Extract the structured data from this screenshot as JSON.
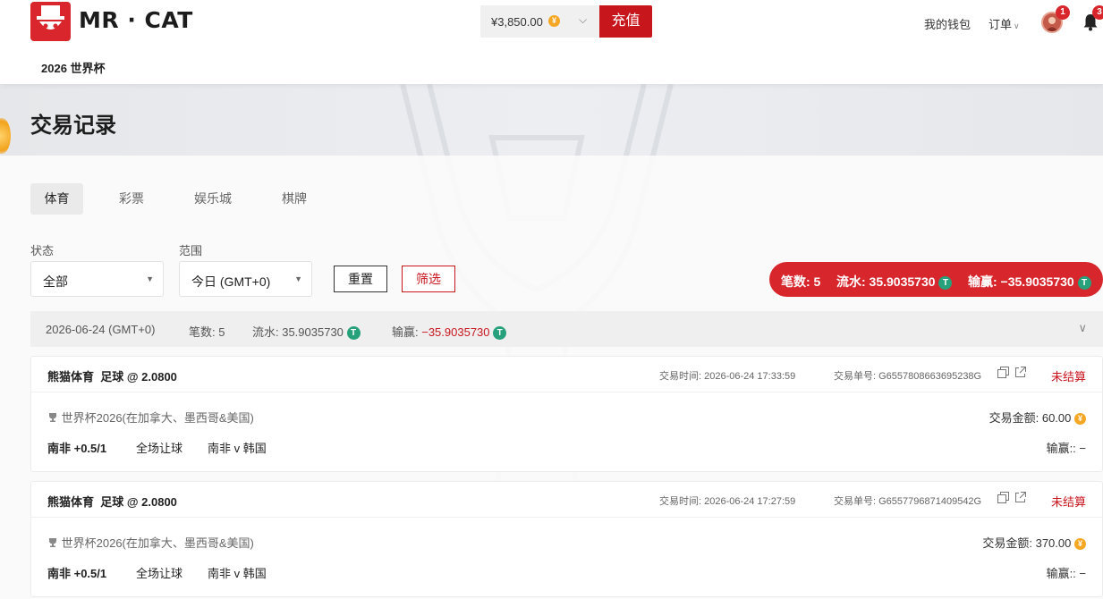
{
  "header": {
    "logo_text": "MR · CAT",
    "subnav": [
      "2026 世界杯"
    ],
    "balance": "¥3,850.00",
    "balance_coin": "¥",
    "recharge_label": "充值",
    "wallet_label": "我的钱包",
    "orders_label": "订单",
    "avatar_badge": "1",
    "bell_badge": "3"
  },
  "page_title": "交易记录",
  "tabs": [
    {
      "label": "体育",
      "active": true
    },
    {
      "label": "彩票",
      "active": false
    },
    {
      "label": "娱乐城",
      "active": false
    },
    {
      "label": "棋牌",
      "active": false
    }
  ],
  "filters": {
    "status_label": "状态",
    "status_value": "全部",
    "range_label": "范围",
    "range_value": "今日 (GMT+0)",
    "reset_label": "重置",
    "filter_label": "筛选"
  },
  "summary": {
    "count_label": "笔数: 5",
    "turnover_label": "流水: 35.9035730",
    "winloss_label": "输赢: −35.9035730",
    "token_symbol": "T"
  },
  "date_group": {
    "date": "2026-06-24 (GMT+0)",
    "count": "笔数: 5",
    "turnover": "流水: 35.9035730",
    "winloss_prefix": "输赢: ",
    "winloss_value": "−35.9035730"
  },
  "transactions": [
    {
      "provider": "熊猫体育",
      "sport_odds": "足球 @ 2.0800",
      "time": "交易时间: 2026-06-24 17:33:59",
      "order_no": "交易单号: G6557808663695238G",
      "status": "未结算",
      "league": "世界杯2026(在加拿大、墨西哥&美国)",
      "amount": "交易金额: 60.00",
      "selection": "南非 +0.5/1",
      "market": "全场让球",
      "match": "南非 v 韩国",
      "winloss": "输赢:: −"
    },
    {
      "provider": "熊猫体育",
      "sport_odds": "足球 @ 2.0800",
      "time": "交易时间: 2026-06-24 17:27:59",
      "order_no": "交易单号: G6557796871409542G",
      "status": "未结算",
      "league": "世界杯2026(在加拿大、墨西哥&美国)",
      "amount": "交易金额: 370.00",
      "selection": "南非 +0.5/1",
      "market": "全场让球",
      "match": "南非 v 韩国",
      "winloss": "输赢:: −"
    }
  ],
  "colors": {
    "brand_red": "#c8161d",
    "tether_green": "#26a17b",
    "coin_gold": "#f5a623"
  }
}
